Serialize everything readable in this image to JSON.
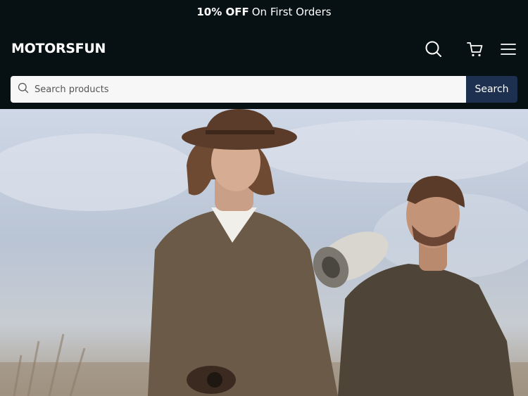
{
  "announcement": {
    "highlight": "10% OFF",
    "text": "On First Orders"
  },
  "header": {
    "logo": "MOTORSFUN",
    "icons": [
      "search-icon",
      "cart-icon",
      "menu-icon"
    ]
  },
  "search": {
    "placeholder": "Search products",
    "button_label": "Search"
  },
  "hero": {
    "image": "hero-banner-image"
  },
  "colors": {
    "background": "#071012",
    "search_button": "#1e3050",
    "text": "#ffffff"
  }
}
